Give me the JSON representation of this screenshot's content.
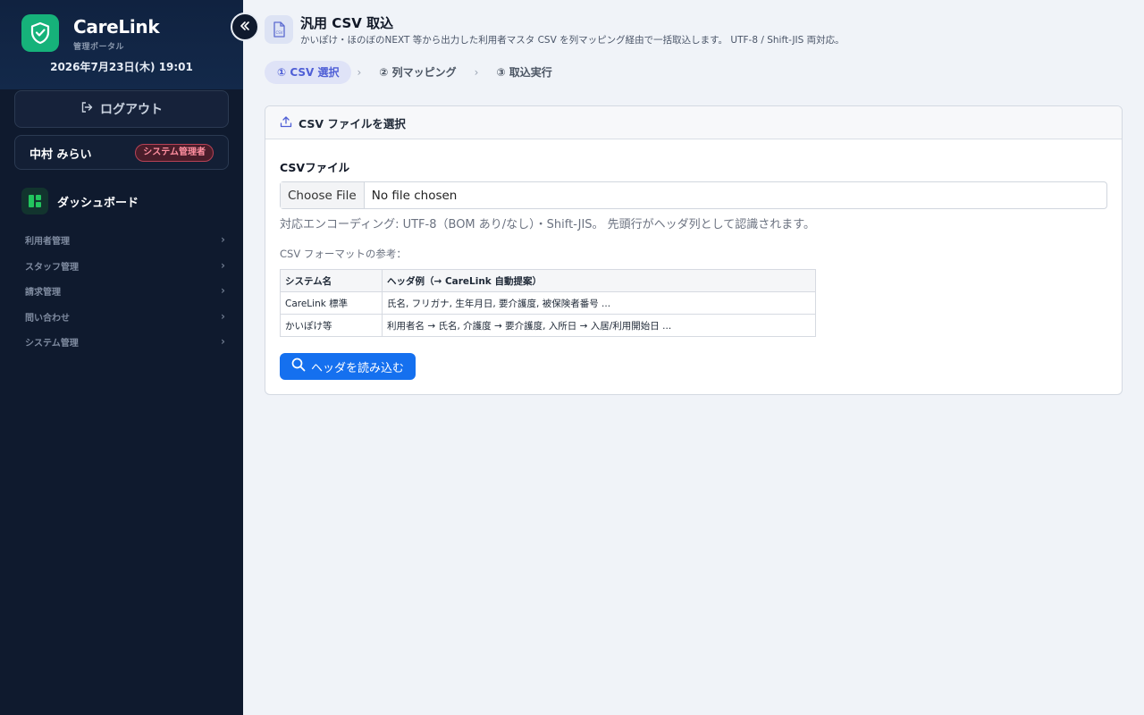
{
  "sidebar": {
    "brand": "CareLink",
    "brand_sub": "管理ポータル",
    "datetime": "2026年7月23日(木) 19:01",
    "logout_label": "ログアウト",
    "user": {
      "name": "中村 みらい",
      "role": "システム管理者"
    },
    "dashboard_label": "ダッシュボード",
    "nav_groups": [
      {
        "label": "利用者管理"
      },
      {
        "label": "スタッフ管理"
      },
      {
        "label": "請求管理"
      },
      {
        "label": "問い合わせ"
      },
      {
        "label": "システム管理"
      }
    ]
  },
  "header": {
    "title": "汎用 CSV 取込",
    "description": "かいぽけ・ほのぼのNEXT 等から出力した利用者マスタ CSV を列マッピング経由で一括取込します。 UTF-8 / Shift-JIS 両対応。"
  },
  "steps": [
    {
      "label": "① CSV 選択",
      "active": true
    },
    {
      "label": "② 列マッピング",
      "active": false
    },
    {
      "label": "③ 取込実行",
      "active": false
    }
  ],
  "card": {
    "title": "CSV ファイルを選択",
    "field_label": "CSVファイル",
    "file_button": "Choose File",
    "file_status": "No file chosen",
    "help": "対応エンコーディング: UTF-8（BOM あり/なし）・Shift-JIS。 先頭行がヘッダ列として認識されます。",
    "format_label": "CSV フォーマットの参考：",
    "table": {
      "headers": [
        "システム名",
        "ヘッダ例（→ CareLink 自動提案）"
      ],
      "rows": [
        [
          "CareLink 標準",
          "氏名, フリガナ, 生年月日, 要介護度, 被保険者番号 ..."
        ],
        [
          "かいぽけ等",
          "利用者名 → 氏名, 介護度 → 要介護度, 入所日 → 入居/利用開始日 ..."
        ]
      ]
    },
    "read_button": "ヘッダを読み込む"
  },
  "colors": {
    "sidebar_bg": "#0f1a2e",
    "brand_green": "#16b27a",
    "primary_blue": "#1570ef",
    "active_step": "#4f5fd6",
    "role_badge": "#ff8fa0"
  },
  "icons": {
    "logo": "shield-check-icon",
    "collapse": "double-chevron-left-icon",
    "logout": "logout-icon",
    "dashboard": "dashboard-grid-icon",
    "page": "csv-file-icon",
    "upload": "upload-icon",
    "search": "search-icon"
  }
}
